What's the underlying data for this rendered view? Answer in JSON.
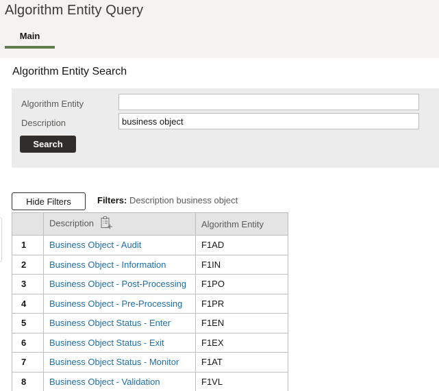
{
  "header": {
    "title": "Algorithm Entity Query",
    "tabs": [
      {
        "label": "Main",
        "active": true
      }
    ]
  },
  "search": {
    "title": "Algorithm Entity Search",
    "fields": [
      {
        "label": "Algorithm Entity",
        "value": "",
        "placeholder": ""
      },
      {
        "label": "Description",
        "value": "business object",
        "placeholder": ""
      }
    ],
    "search_label": "Search"
  },
  "filters": {
    "hide_label": "Hide Filters",
    "prefix": "Filters:",
    "summary": "Description business object"
  },
  "table": {
    "columns": [
      "",
      "Description",
      "Algorithm Entity"
    ],
    "description_header_icon": "clipboard-list-add-icon",
    "rows": [
      {
        "num": "1",
        "description": "Business Object - Audit",
        "entity": "F1AD"
      },
      {
        "num": "2",
        "description": "Business Object - Information",
        "entity": "F1IN"
      },
      {
        "num": "3",
        "description": "Business Object - Post-Processing",
        "entity": "F1PO"
      },
      {
        "num": "4",
        "description": "Business Object - Pre-Processing",
        "entity": "F1PR"
      },
      {
        "num": "5",
        "description": "Business Object Status - Enter",
        "entity": "F1EN"
      },
      {
        "num": "6",
        "description": "Business Object Status - Exit",
        "entity": "F1EX"
      },
      {
        "num": "7",
        "description": "Business Object Status - Monitor",
        "entity": "F1AT"
      },
      {
        "num": "8",
        "description": "Business Object - Validation",
        "entity": "F1VL"
      }
    ]
  },
  "colors": {
    "tab_accent": "#5f7d4f",
    "link": "#1e6ea7",
    "primary_button": "#312d2a"
  }
}
